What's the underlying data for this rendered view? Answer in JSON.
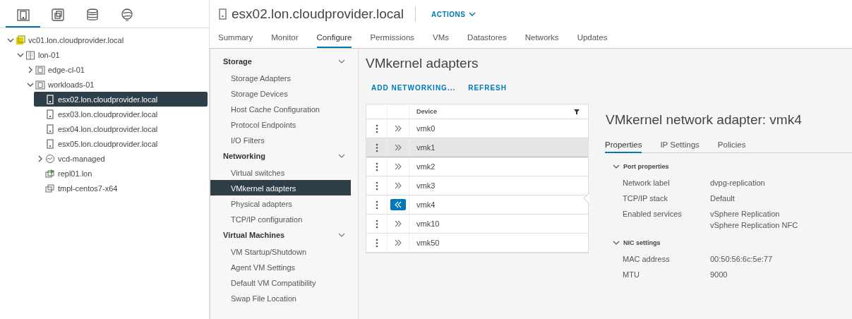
{
  "nav_tabs": [
    {
      "kind": "hosts",
      "selected": true
    },
    {
      "kind": "vms",
      "selected": false
    },
    {
      "kind": "storage",
      "selected": false
    },
    {
      "kind": "network",
      "selected": false
    }
  ],
  "tree": [
    {
      "label": "vc01.lon.cloudprovider.local",
      "kind": "vcenter",
      "expanded": true,
      "selected": false,
      "children": [
        {
          "label": "lon-01",
          "kind": "datacenter",
          "expanded": true,
          "selected": false,
          "children": [
            {
              "label": "edge-cl-01",
              "kind": "cluster",
              "expanded": false,
              "selected": false
            },
            {
              "label": "workloads-01",
              "kind": "cluster",
              "expanded": true,
              "selected": false,
              "children": [
                {
                  "label": "esx02.lon.cloudprovider.local",
                  "kind": "host",
                  "selected": true
                },
                {
                  "label": "esx03.lon.cloudprovider.local",
                  "kind": "host",
                  "selected": false
                },
                {
                  "label": "esx04.lon.cloudprovider.local",
                  "kind": "host",
                  "selected": false
                },
                {
                  "label": "esx05.lon.cloudprovider.local",
                  "kind": "host",
                  "selected": false
                },
                {
                  "label": "vcd-managed",
                  "kind": "pool",
                  "expanded": false,
                  "selected": false
                },
                {
                  "label": "repl01.lon",
                  "kind": "vm-on",
                  "selected": false
                },
                {
                  "label": "tmpl-centos7-x64",
                  "kind": "template",
                  "selected": false
                }
              ]
            }
          ]
        }
      ]
    }
  ],
  "header": {
    "title": "esx02.lon.cloudprovider.local",
    "actions": "ACTIONS"
  },
  "tabs": [
    {
      "label": "Summary",
      "selected": false
    },
    {
      "label": "Monitor",
      "selected": false
    },
    {
      "label": "Configure",
      "selected": true
    },
    {
      "label": "Permissions",
      "selected": false
    },
    {
      "label": "VMs",
      "selected": false
    },
    {
      "label": "Datastores",
      "selected": false
    },
    {
      "label": "Networks",
      "selected": false
    },
    {
      "label": "Updates",
      "selected": false
    }
  ],
  "config_menu": [
    {
      "title": "Storage",
      "expanded": true,
      "items": [
        {
          "label": "Storage Adapters",
          "selected": false
        },
        {
          "label": "Storage Devices",
          "selected": false
        },
        {
          "label": "Host Cache Configuration",
          "selected": false
        },
        {
          "label": "Protocol Endpoints",
          "selected": false
        },
        {
          "label": "I/O Filters",
          "selected": false
        }
      ]
    },
    {
      "title": "Networking",
      "expanded": true,
      "items": [
        {
          "label": "Virtual switches",
          "selected": false
        },
        {
          "label": "VMkernel adapters",
          "selected": true
        },
        {
          "label": "Physical adapters",
          "selected": false
        },
        {
          "label": "TCP/IP configuration",
          "selected": false
        }
      ]
    },
    {
      "title": "Virtual Machines",
      "expanded": true,
      "items": [
        {
          "label": "VM Startup/Shutdown",
          "selected": false
        },
        {
          "label": "Agent VM Settings",
          "selected": false
        },
        {
          "label": "Default VM Compatibility",
          "selected": false
        },
        {
          "label": "Swap File Location",
          "selected": false
        }
      ]
    }
  ],
  "content": {
    "title": "VMkernel adapters",
    "actions": [
      "ADD NETWORKING...",
      "REFRESH"
    ]
  },
  "table": {
    "columns": [
      "Device"
    ],
    "rows": [
      {
        "device": "vmk0",
        "selected": false,
        "hovered": false
      },
      {
        "device": "vmk1",
        "selected": false,
        "hovered": true
      },
      {
        "device": "vmk2",
        "selected": false,
        "hovered": false
      },
      {
        "device": "vmk3",
        "selected": false,
        "hovered": false
      },
      {
        "device": "vmk4",
        "selected": true,
        "hovered": false
      },
      {
        "device": "vmk10",
        "selected": false,
        "hovered": false
      },
      {
        "device": "vmk50",
        "selected": false,
        "hovered": false
      }
    ]
  },
  "details": {
    "title": "VMkernel network adapter: vmk4",
    "tabs": [
      {
        "label": "Properties",
        "selected": true
      },
      {
        "label": "IP Settings",
        "selected": false
      },
      {
        "label": "Policies",
        "selected": false
      }
    ],
    "sections": [
      {
        "title": "Port properties",
        "expanded": true,
        "fields": [
          {
            "label": "Network label",
            "values": [
              "dvpg-replication"
            ]
          },
          {
            "label": "TCP/IP stack",
            "values": [
              "Default"
            ]
          },
          {
            "label": "Enabled services",
            "values": [
              "vSphere Replication",
              "vSphere Replication NFC"
            ]
          }
        ]
      },
      {
        "title": "NIC settings",
        "expanded": true,
        "fields": [
          {
            "label": "MAC address",
            "values": [
              "00:50:56:6c:5e:77"
            ]
          },
          {
            "label": "MTU",
            "values": [
              "9000"
            ]
          }
        ]
      }
    ]
  }
}
